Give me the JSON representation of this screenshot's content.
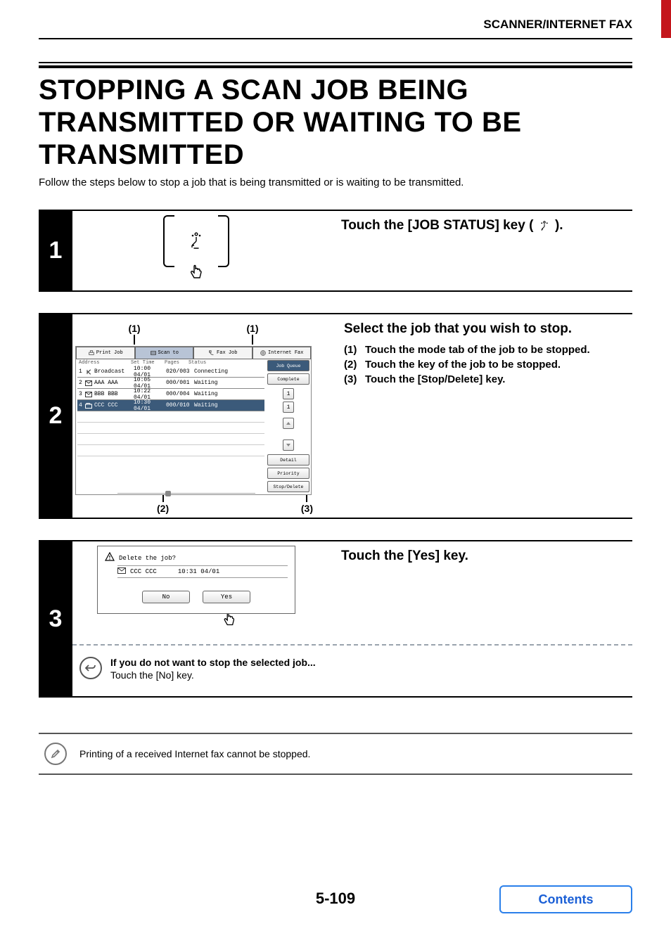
{
  "header": {
    "section": "SCANNER/INTERNET FAX"
  },
  "title": "STOPPING A SCAN JOB BEING TRANSMITTED OR WAITING TO BE TRANSMITTED",
  "intro": "Follow the steps below to stop a job that is being transmitted or is waiting to be transmitted.",
  "steps": [
    {
      "num": "1",
      "heading_a": "Touch the [JOB STATUS] key (",
      "heading_b": ")."
    },
    {
      "num": "2",
      "heading": "Select the job that you wish to stop.",
      "callouts": {
        "c1": "(1)",
        "c2": "(2)",
        "c3": "(3)"
      },
      "subs": [
        {
          "n": "(1)",
          "t": "Touch the mode tab of the job to be stopped."
        },
        {
          "n": "(2)",
          "t": "Touch the key of the job to be stopped."
        },
        {
          "n": "(3)",
          "t": "Touch the [Stop/Delete] key."
        }
      ],
      "screen": {
        "tabs": [
          "Print Job",
          "Scan to",
          "Fax Job",
          "Internet Fax"
        ],
        "cols": [
          "Address",
          "Set Time",
          "Pages",
          "Status"
        ],
        "rows": [
          {
            "n": "1",
            "addr": "Broadcast",
            "time": "10:00 04/01",
            "pages": "020/003",
            "status": "Connecting"
          },
          {
            "n": "2",
            "addr": "AAA AAA",
            "time": "10:05 04/01",
            "pages": "000/001",
            "status": "Waiting"
          },
          {
            "n": "3",
            "addr": "BBB BBB",
            "time": "10:22 04/01",
            "pages": "000/004",
            "status": "Waiting"
          },
          {
            "n": "4",
            "addr": "CCC CCC",
            "time": "10:30 04/01",
            "pages": "000/010",
            "status": "Waiting"
          }
        ],
        "spin": [
          "1",
          "1"
        ],
        "side": [
          "Job Queue",
          "Complete",
          "Detail",
          "Priority",
          "Stop/Delete"
        ]
      }
    },
    {
      "num": "3",
      "heading": "Touch the [Yes] key.",
      "dialog": {
        "title": "Delete the job?",
        "job": "CCC CCC",
        "time": "10:31 04/01",
        "no": "No",
        "yes": "Yes"
      },
      "alt": {
        "h": "If you do not want to stop the selected job...",
        "t": "Touch the [No] key."
      }
    }
  ],
  "note": "Printing of a received Internet fax cannot be stopped.",
  "page_no": "5-109",
  "contents_label": "Contents"
}
